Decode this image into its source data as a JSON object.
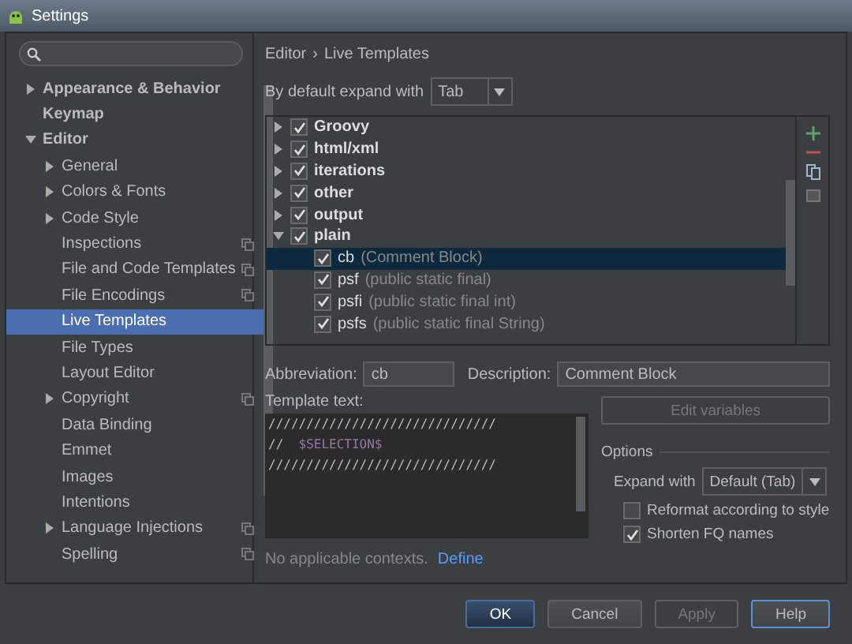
{
  "window": {
    "title": "Settings"
  },
  "sidebar": {
    "items": [
      {
        "label": "Appearance & Behavior",
        "expandable": true,
        "expanded": false,
        "bold": true,
        "project_scope": false,
        "selected": false
      },
      {
        "label": "Keymap",
        "expandable": false,
        "expanded": false,
        "bold": true,
        "project_scope": false,
        "selected": false
      },
      {
        "label": "Editor",
        "expandable": true,
        "expanded": true,
        "bold": true,
        "project_scope": false,
        "selected": false,
        "children": [
          {
            "label": "General",
            "expandable": true,
            "expanded": false,
            "project_scope": false,
            "selected": false
          },
          {
            "label": "Colors & Fonts",
            "expandable": true,
            "expanded": false,
            "project_scope": false,
            "selected": false
          },
          {
            "label": "Code Style",
            "expandable": true,
            "expanded": false,
            "project_scope": false,
            "selected": false
          },
          {
            "label": "Inspections",
            "expandable": false,
            "expanded": false,
            "project_scope": true,
            "selected": false
          },
          {
            "label": "File and Code Templates",
            "expandable": false,
            "expanded": false,
            "project_scope": true,
            "selected": false
          },
          {
            "label": "File Encodings",
            "expandable": false,
            "expanded": false,
            "project_scope": true,
            "selected": false
          },
          {
            "label": "Live Templates",
            "expandable": false,
            "expanded": false,
            "project_scope": false,
            "selected": true
          },
          {
            "label": "File Types",
            "expandable": false,
            "expanded": false,
            "project_scope": false,
            "selected": false
          },
          {
            "label": "Layout Editor",
            "expandable": false,
            "expanded": false,
            "project_scope": false,
            "selected": false
          },
          {
            "label": "Copyright",
            "expandable": true,
            "expanded": false,
            "project_scope": true,
            "selected": false
          },
          {
            "label": "Data Binding",
            "expandable": false,
            "expanded": false,
            "project_scope": false,
            "selected": false
          },
          {
            "label": "Emmet",
            "expandable": false,
            "expanded": false,
            "project_scope": false,
            "selected": false
          },
          {
            "label": "Images",
            "expandable": false,
            "expanded": false,
            "project_scope": false,
            "selected": false
          },
          {
            "label": "Intentions",
            "expandable": false,
            "expanded": false,
            "project_scope": false,
            "selected": false
          },
          {
            "label": "Language Injections",
            "expandable": true,
            "expanded": false,
            "project_scope": true,
            "selected": false
          },
          {
            "label": "Spelling",
            "expandable": false,
            "expanded": false,
            "project_scope": true,
            "selected": false
          }
        ]
      }
    ]
  },
  "breadcrumb": [
    {
      "label": "Editor"
    },
    {
      "label": "Live Templates"
    }
  ],
  "breadcrumb_separator": "›",
  "expand_default": {
    "label": "By default expand with",
    "value": "Tab"
  },
  "templates": [
    {
      "name": "Groovy",
      "expanded": false,
      "checked": true
    },
    {
      "name": "html/xml",
      "expanded": false,
      "checked": true
    },
    {
      "name": "iterations",
      "expanded": false,
      "checked": true
    },
    {
      "name": "other",
      "expanded": false,
      "checked": true
    },
    {
      "name": "output",
      "expanded": false,
      "checked": true
    },
    {
      "name": "plain",
      "expanded": true,
      "checked": true,
      "children": [
        {
          "abbreviation": "cb",
          "description": "(Comment Block)",
          "checked": true,
          "selected": true
        },
        {
          "abbreviation": "psf",
          "description": "(public static final)",
          "checked": true,
          "selected": false
        },
        {
          "abbreviation": "psfi",
          "description": "(public static final int)",
          "checked": true,
          "selected": false
        },
        {
          "abbreviation": "psfs",
          "description": "(public static final String)",
          "checked": true,
          "selected": false
        }
      ]
    }
  ],
  "abbreviation": {
    "label": "Abbreviation:",
    "value": "cb"
  },
  "description": {
    "label": "Description:",
    "value": "Comment Block"
  },
  "template_text": {
    "label": "Template text:",
    "lines": [
      [
        {
          "kind": "comment",
          "text": "//////////////////////////////"
        }
      ],
      [
        {
          "kind": "comment",
          "text": "//  "
        },
        {
          "kind": "variable",
          "text": "$SELECTION$"
        }
      ],
      [
        {
          "kind": "comment",
          "text": "//////////////////////////////"
        }
      ]
    ]
  },
  "edit_variables": {
    "label": "Edit variables",
    "disabled": true
  },
  "options": {
    "title": "Options",
    "expand_with": {
      "label": "Expand with",
      "value": "Default (Tab)"
    },
    "checkboxes": [
      {
        "label": "Reformat according to style",
        "checked": false
      },
      {
        "label": "Shorten FQ names",
        "checked": true
      }
    ]
  },
  "contexts": {
    "text": "No applicable contexts.",
    "link": "Define"
  },
  "buttons": [
    {
      "label": "OK",
      "kind": "default",
      "disabled": false
    },
    {
      "label": "Cancel",
      "kind": "normal",
      "disabled": false
    },
    {
      "label": "Apply",
      "kind": "normal",
      "disabled": true
    },
    {
      "label": "Help",
      "kind": "focused",
      "disabled": false
    }
  ]
}
